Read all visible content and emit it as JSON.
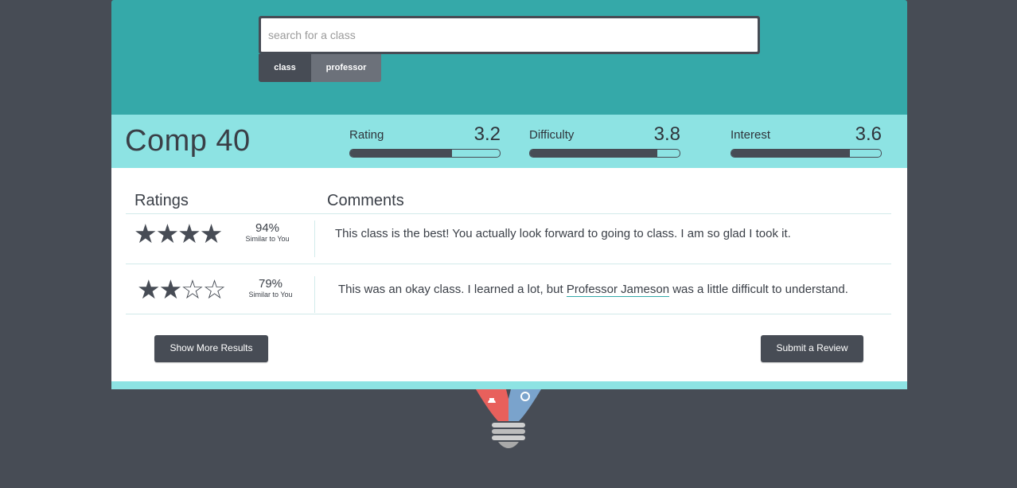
{
  "search": {
    "placeholder": "search for a class",
    "value": "",
    "tabs": [
      {
        "label": "class",
        "active": true
      },
      {
        "label": "professor",
        "active": false
      }
    ]
  },
  "course": {
    "title": "Comp 40",
    "metrics": [
      {
        "label": "Rating",
        "value": "3.2",
        "fill_fraction": 0.68
      },
      {
        "label": "Difficulty",
        "value": "3.8",
        "fill_fraction": 0.85
      },
      {
        "label": "Interest",
        "value": "3.6",
        "fill_fraction": 0.79
      }
    ]
  },
  "reviews": {
    "ratings_header": "Ratings",
    "comments_header": "Comments",
    "items": [
      {
        "stars": 4,
        "stars_text": "★★★★",
        "similarity_pct": "94%",
        "similarity_label": "Similar to You",
        "comment_before": "This class is the best! You actually look forward to going to class. I am so glad I took it.",
        "comment_link": "",
        "comment_after": ""
      },
      {
        "stars": 2,
        "stars_text": "★★☆☆",
        "similarity_pct": "79%",
        "similarity_label": "Similar to You",
        "comment_before": "This was an okay class. I learned a lot, but ",
        "comment_link": "Professor Jameson",
        "comment_after": " was a little difficult to understand."
      }
    ]
  },
  "actions": {
    "show_more": "Show More Results",
    "submit_review": "Submit a Review"
  },
  "colors": {
    "header": "#35a9a9",
    "summary": "#8de3e3",
    "dark": "#474c55",
    "logo_red": "#e8605c",
    "logo_blue": "#7aa3cc"
  }
}
